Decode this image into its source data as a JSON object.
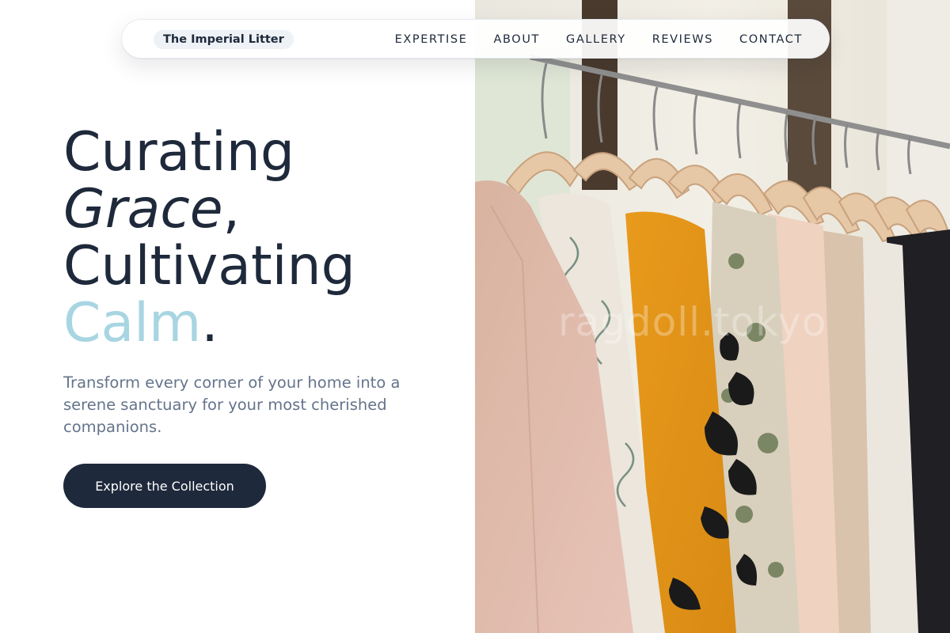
{
  "nav": {
    "brand": "The Imperial Litter",
    "links": [
      "EXPERTISE",
      "ABOUT",
      "GALLERY",
      "REVIEWS",
      "CONTACT"
    ]
  },
  "hero": {
    "line1": "Curating",
    "line2_em": "Grace",
    "line2_punct": ",",
    "line3": "Cultivating",
    "line4_accent": "Calm",
    "line4_punct": ".",
    "subtitle": "Transform every corner of your home into a serene sanctuary for your most cherished companions.",
    "cta_label": "Explore the Collection"
  },
  "photo": {
    "subject": "garments on wooden hangers on a clothing rack",
    "watermark": "ragdoll.tokyo"
  },
  "colors": {
    "primary": "#1e293b",
    "accent": "#a8d5e2",
    "muted_text": "#64748b",
    "background": "#ffffff"
  }
}
